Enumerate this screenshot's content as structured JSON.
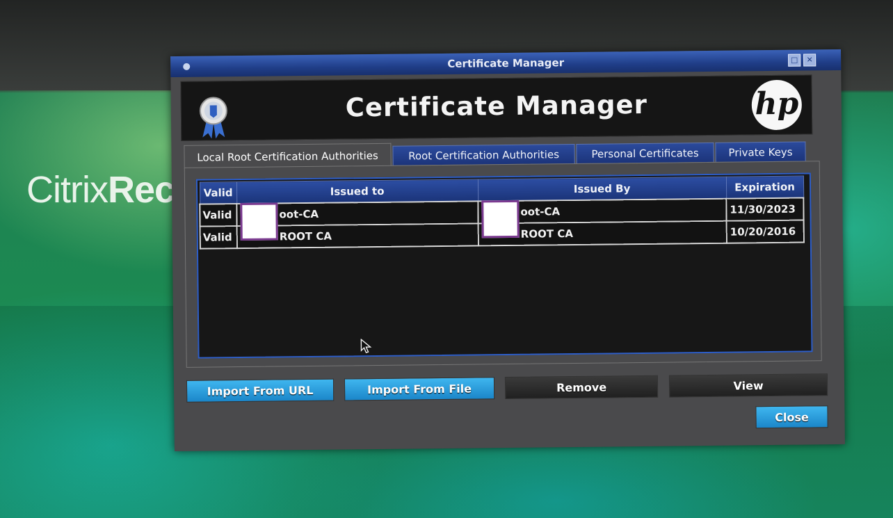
{
  "background": {
    "brand_text_light": "Citrix",
    "brand_text_bold": "Rec"
  },
  "window": {
    "title": "Certificate Manager",
    "header_title": "Certificate Manager",
    "logo_text": "hp"
  },
  "tabs": [
    {
      "label": "Local Root Certification Authorities",
      "active": true
    },
    {
      "label": "Root Certification Authorities",
      "active": false
    },
    {
      "label": "Personal Certificates",
      "active": false
    },
    {
      "label": "Private Keys",
      "active": false
    }
  ],
  "table": {
    "columns": [
      "Valid",
      "Issued to",
      "Issued By",
      "Expiration"
    ],
    "rows": [
      {
        "valid": "Valid",
        "issued_to": "oot-CA",
        "issued_by": "oot-CA",
        "expiration": "11/30/2023"
      },
      {
        "valid": "Valid",
        "issued_to": "ROOT CA",
        "issued_by": "ROOT CA",
        "expiration": "10/20/2016"
      }
    ]
  },
  "buttons": {
    "import_url": "Import From URL",
    "import_file": "Import From File",
    "remove": "Remove",
    "view": "View",
    "close": "Close"
  },
  "colors": {
    "titlebar": "#203e88",
    "button_primary": "#1b86c9",
    "button_disabled": "#2a2a2a",
    "redaction_border": "#7b3a90"
  }
}
